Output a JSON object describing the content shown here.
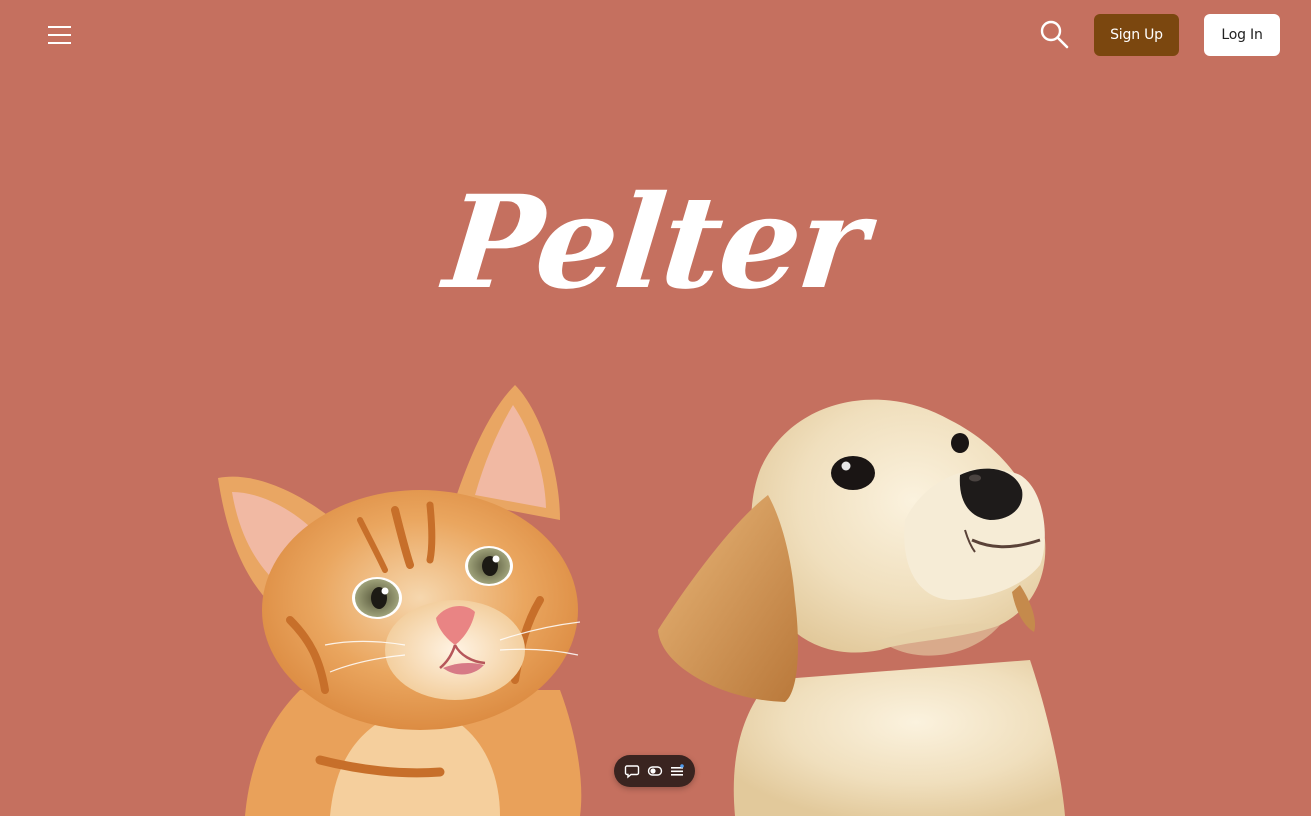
{
  "header": {
    "menu_icon": "hamburger-menu-icon",
    "search_icon": "search-icon",
    "signup_label": "Sign Up",
    "login_label": "Log In"
  },
  "hero": {
    "brand_title": "Pelter",
    "left_image": "orange-kitten",
    "right_image": "labrador-puppy"
  },
  "floating_toolbar": {
    "icons": [
      "chat-bubble-icon",
      "toggle-icon",
      "list-icon"
    ]
  },
  "colors": {
    "background": "#c5705f",
    "signup_button": "#7b470f",
    "login_button": "#ffffff",
    "brand_text": "#ffffff",
    "toolbar": "#3a2420"
  }
}
